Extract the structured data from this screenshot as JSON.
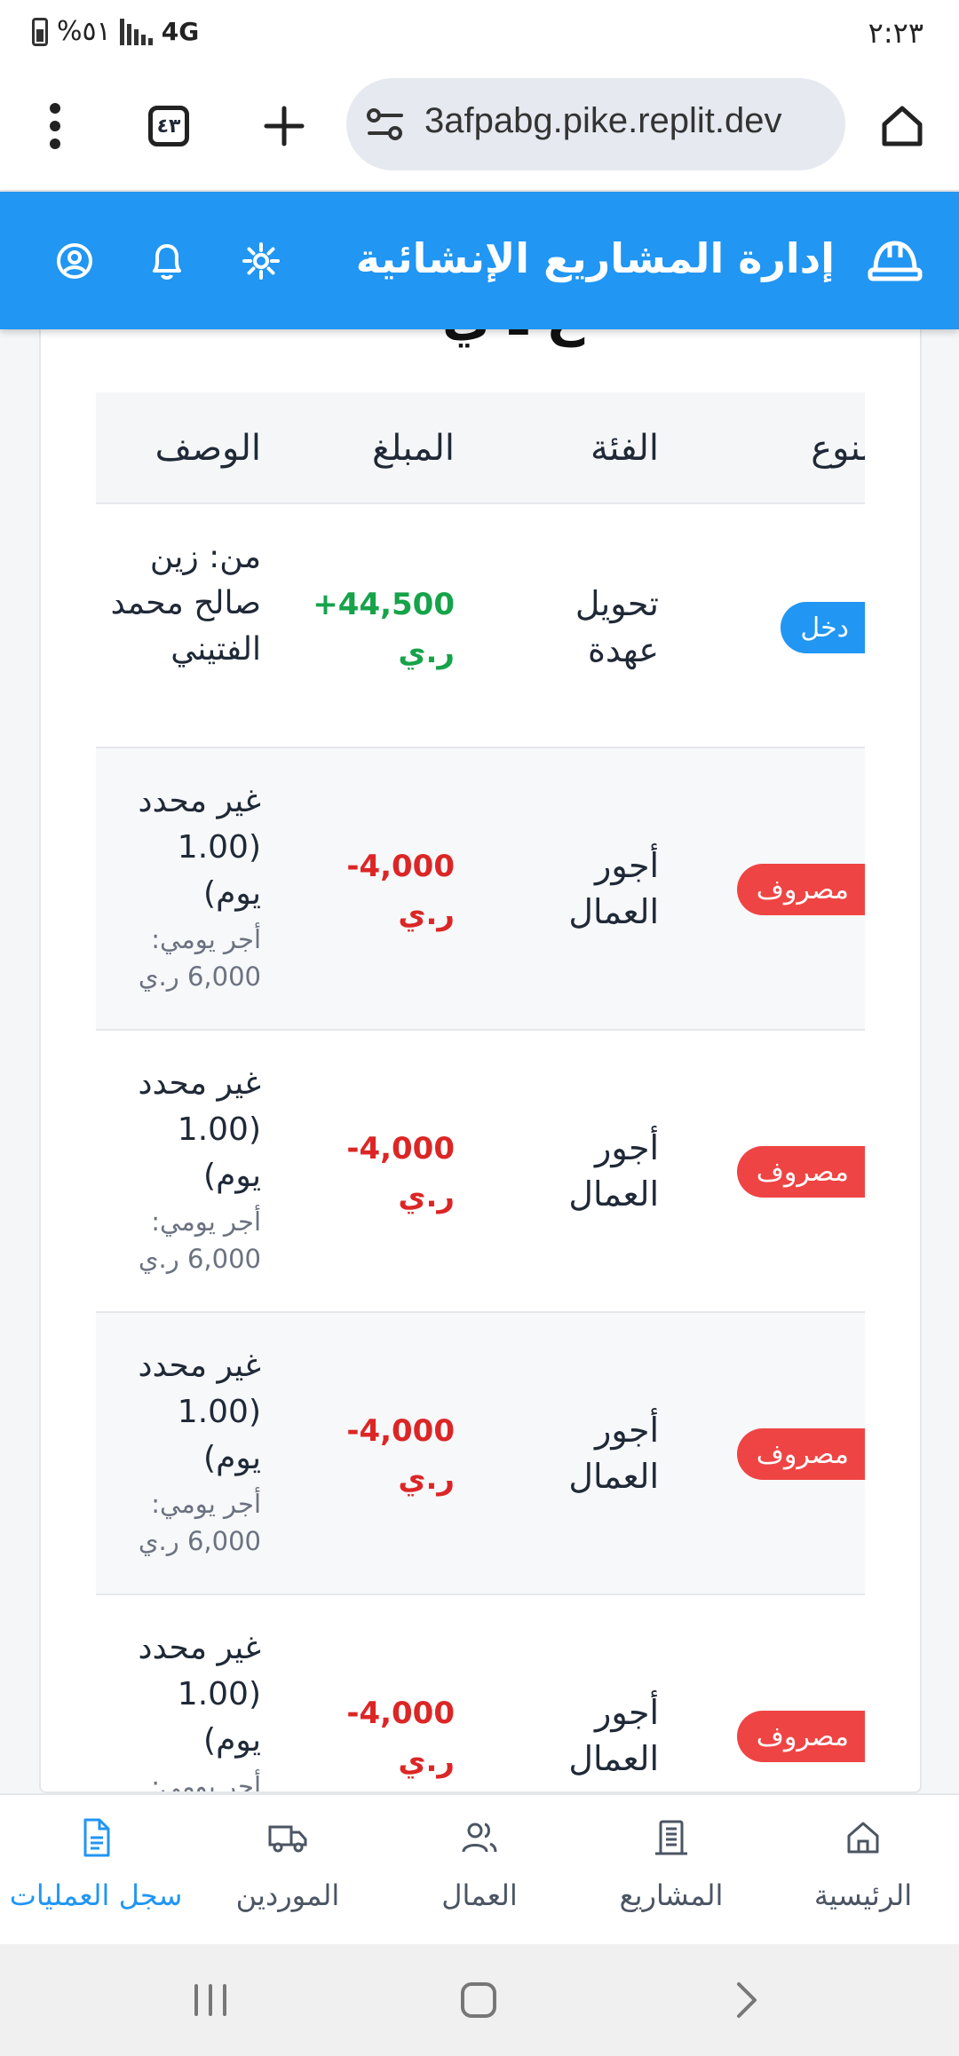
{
  "status_bar": {
    "battery": "%٥١",
    "network": "4G",
    "time": "٢:٢٣"
  },
  "browser": {
    "url": "3afpabg.pike.replit.dev",
    "tab_count": "٤٣"
  },
  "app": {
    "title": "إدارة المشاريع الإنشائية",
    "partial_heading": "ع ـ ي"
  },
  "table": {
    "headers": {
      "type": "لنوع",
      "category": "الفئة",
      "amount": "المبلغ",
      "description": "الوصف"
    },
    "rows": [
      {
        "type": "دخل",
        "category": "تحويل عهدة",
        "amount": "+44,500",
        "currency": "ر.ي",
        "description": "من: زين صالح محمد الفتيني",
        "detail": ""
      },
      {
        "type": "مصروف",
        "category": "أجور العمال",
        "amount": "-4,000",
        "currency": "ر.ي",
        "description": "غير محدد (1.00 يوم)",
        "detail": "أجر يومي: 6,000 ر.ي"
      },
      {
        "type": "مصروف",
        "category": "أجور العمال",
        "amount": "-4,000",
        "currency": "ر.ي",
        "description": "غير محدد (1.00 يوم)",
        "detail": "أجر يومي: 6,000 ر.ي"
      },
      {
        "type": "مصروف",
        "category": "أجور العمال",
        "amount": "-4,000",
        "currency": "ر.ي",
        "description": "غير محدد (1.00 يوم)",
        "detail": "أجر يومي: 6,000 ر.ي"
      },
      {
        "type": "مصروف",
        "category": "أجور العمال",
        "amount": "-4,000",
        "currency": "ر.ي",
        "description": "غير محدد (1.00 يوم)",
        "detail": "أجر يومي:"
      }
    ]
  },
  "bottom_nav": {
    "home": "الرئيسية",
    "projects": "المشاريع",
    "workers": "العمال",
    "suppliers": "الموردين",
    "transactions": "سجل العمليات"
  },
  "colors": {
    "primary": "#2196f3",
    "income": "#16a34a",
    "expense": "#dc2626"
  }
}
